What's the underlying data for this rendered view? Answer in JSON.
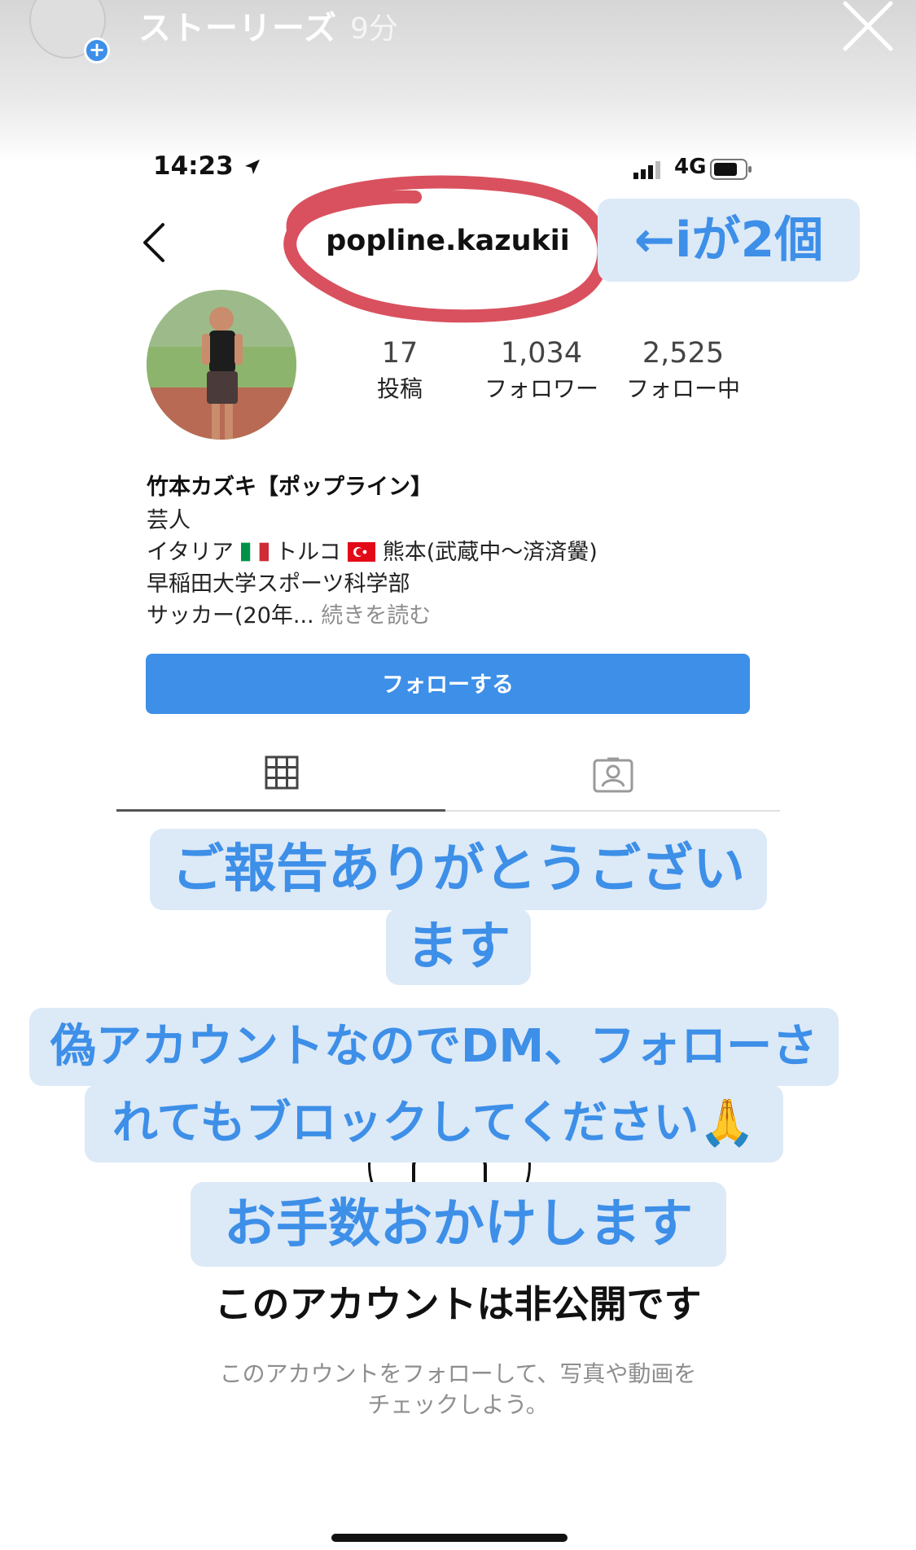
{
  "story": {
    "title": "ストーリーズ",
    "time": "9分"
  },
  "status_bar": {
    "time": "14:23",
    "network": "4G"
  },
  "profile": {
    "username": "popline.kazukii",
    "stats": [
      {
        "value": "17",
        "label": "投稿"
      },
      {
        "value": "1,034",
        "label": "フォロワー"
      },
      {
        "value": "2,525",
        "label": "フォロー中"
      }
    ],
    "name": "竹本カズキ【ポップライン】",
    "bio": {
      "line1": "芸人",
      "line2_a": "イタリア",
      "line2_b": "トルコ",
      "line2_c": "熊本(武蔵中〜済済黌)",
      "line3": "早稲田大学スポーツ科学部",
      "line4": "サッカー(20年...",
      "more": " 続きを読む"
    },
    "follow_button": "フォローする",
    "private_title": "このアカウントは非公開です",
    "private_desc_1": "このアカウントをフォローして、写真や動画を",
    "private_desc_2": "チェックしよう。"
  },
  "stickers": {
    "arrow_note": "←iが2個",
    "thanks_1": "ご報告ありがとうござい",
    "thanks_2": "ます",
    "fake_1": "偽アカウントなのでDM、フォローさ",
    "fake_2": "れてもブロックしてください🙏",
    "sorry": "お手数おかけします"
  },
  "colors": {
    "accent": "#3d8fe8",
    "sticker_bg": "#dce9f7",
    "ring": "#d9515e"
  },
  "icons": [
    "close-icon",
    "back-chevron-icon",
    "grid-icon",
    "tagged-icon",
    "location-arrow-icon",
    "signal-icon",
    "battery-icon",
    "add-icon"
  ]
}
